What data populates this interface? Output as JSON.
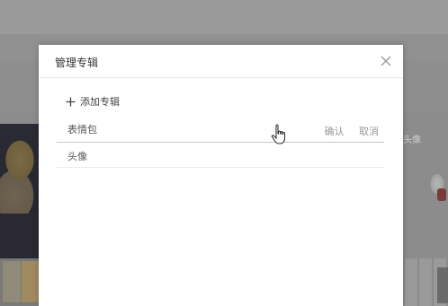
{
  "background": {
    "right_side_text": "头像"
  },
  "dialog": {
    "title": "管理专辑",
    "close_icon": "close-icon",
    "add_album_label": "添加专辑",
    "add_icon": "plus-icon",
    "albums": [
      {
        "name": "表情包",
        "editing": true,
        "confirm_label": "确认",
        "cancel_label": "取消"
      },
      {
        "name": "头像",
        "editing": false
      }
    ]
  },
  "cursor": "hand-pointer-icon"
}
